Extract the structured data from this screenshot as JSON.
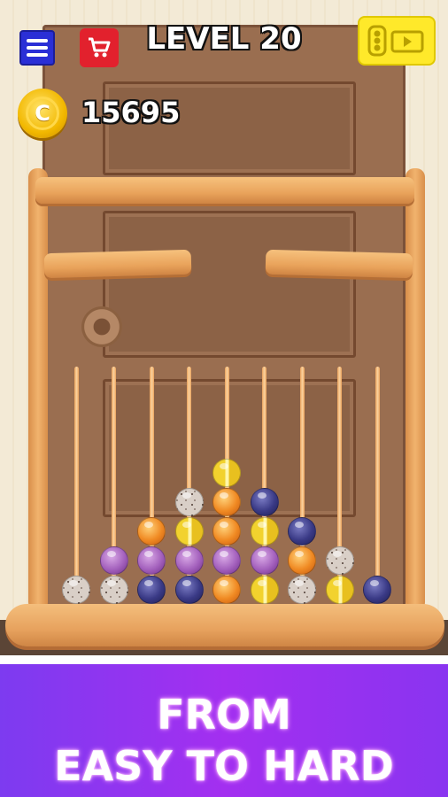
{
  "header": {
    "level_label": "LEVEL 20",
    "coins": "15695",
    "coin_symbol": "C"
  },
  "buttons": {
    "menu": "menu-icon",
    "shop": "cart-icon",
    "video": "video-reward-icon"
  },
  "board": {
    "rod_count": 9,
    "columns": [
      [
        "stone"
      ],
      [
        "stone",
        "purple"
      ],
      [
        "navy",
        "purple",
        "orange"
      ],
      [
        "navy",
        "purple",
        "yellow",
        "stone"
      ],
      [
        "orange",
        "purple",
        "orange",
        "orange",
        "yellow"
      ],
      [
        "yellow",
        "purple",
        "yellow",
        "navy"
      ],
      [
        "stone",
        "orange",
        "navy"
      ],
      [
        "yellow",
        "stone"
      ],
      [
        "navy"
      ]
    ]
  },
  "banner": {
    "line1": "FROM",
    "line2": "EASY TO HARD"
  },
  "colors": {
    "banner_purple": "#8a34f0",
    "menu_blue": "#2a2fd6",
    "shop_red": "#e2212d",
    "video_yellow": "#ffe92a"
  }
}
